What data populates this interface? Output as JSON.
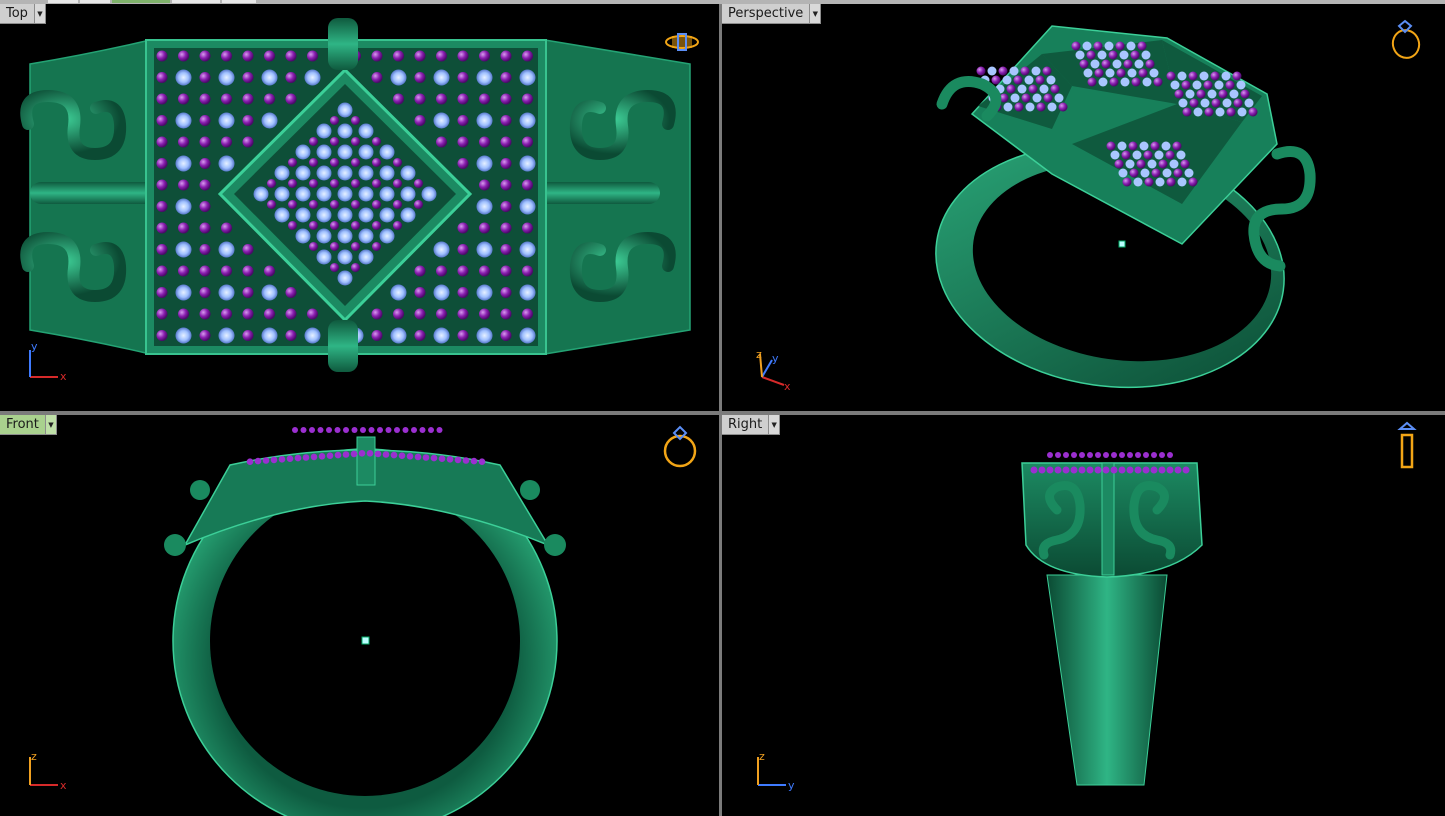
{
  "viewports": {
    "top": {
      "label": "Top",
      "x_axis": "x",
      "y_axis": "y"
    },
    "perspective": {
      "label": "Perspective",
      "x_axis": "x",
      "y_axis": "y",
      "z_axis": "z"
    },
    "front": {
      "label": "Front",
      "x_axis": "x",
      "z_axis": "z"
    },
    "right": {
      "label": "Right",
      "y_axis": "y",
      "z_axis": "z"
    }
  },
  "active_viewport": "Front",
  "colors": {
    "background": "#000000",
    "ring_metal": "#1f8a63",
    "gem_purple": "#8a1fb0",
    "gem_blue": "#8fb6ff",
    "view_icon": "#f2a516",
    "axis_x": "#d62a2a",
    "axis_y": "#3f7bff",
    "axis_z": "#f0a020",
    "active_tab": "#a9d18e",
    "inactive_tab": "#cfcfcf"
  },
  "icons": {
    "top": "ring-top-view-icon",
    "perspective": "ring-perspective-view-icon",
    "front": "ring-front-view-icon",
    "right": "ring-side-view-icon"
  }
}
